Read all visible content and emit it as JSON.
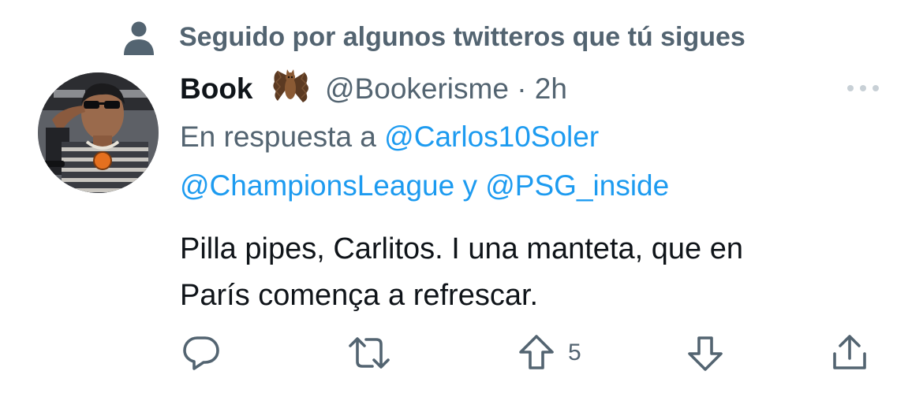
{
  "social_context": {
    "text": "Seguido por algunos twitteros que tú sigues",
    "icon": "person-icon"
  },
  "tweet": {
    "author_name": "Book",
    "author_emoji": "bat-icon",
    "handle_time": "@Bookerisme · 2h",
    "reply": {
      "prefix": "En respuesta a",
      "mention_1": "@Carlos10Soler",
      "mention_2": "@ChampionsLeague",
      "connector": "y",
      "mention_3": "@PSG_inside"
    },
    "text_lines": [
      "Pilla pipes, Carlitos. I una manteta, que en",
      "París comença a refrescar."
    ]
  },
  "actions": {
    "reply_icon": "reply-icon",
    "retweet_icon": "retweet-icon",
    "upvote_icon": "upvote-icon",
    "upvote_count": "5",
    "downvote_icon": "downvote-icon",
    "share_icon": "share-icon"
  },
  "colors": {
    "text_primary": "#0f1419",
    "text_secondary": "#536471",
    "link": "#1d9bf0",
    "background": "#ffffff"
  }
}
